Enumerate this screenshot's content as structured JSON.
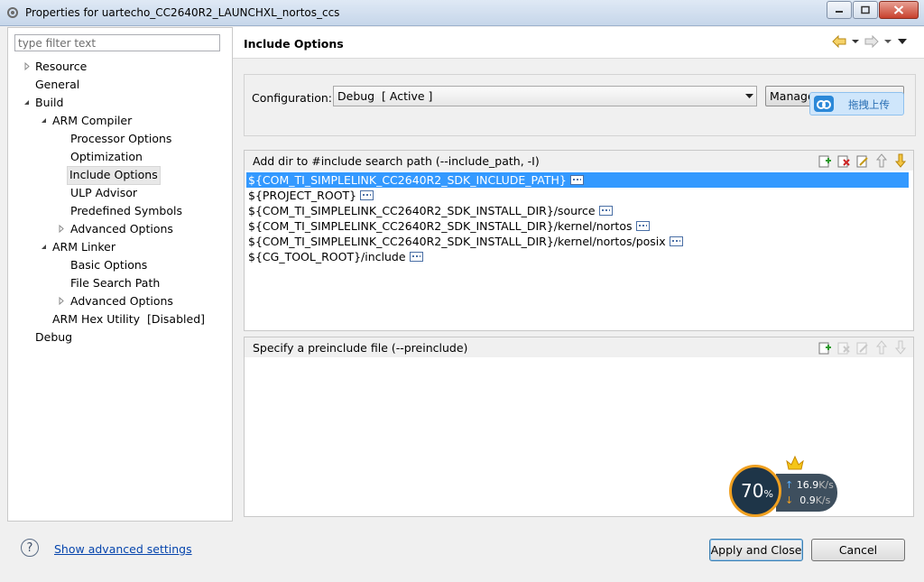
{
  "window": {
    "title": "Properties for uartecho_CC2640R2_LAUNCHXL_nortos_ccs"
  },
  "filter": {
    "placeholder": "type filter text"
  },
  "tree": {
    "resource": "Resource",
    "general": "General",
    "build": "Build",
    "arm_compiler": "ARM Compiler",
    "processor_options": "Processor Options",
    "optimization": "Optimization",
    "include_options": "Include Options",
    "ulp_advisor": "ULP Advisor",
    "predefined_symbols": "Predefined Symbols",
    "advanced_options_compiler": "Advanced Options",
    "arm_linker": "ARM Linker",
    "basic_options": "Basic Options",
    "file_search_path": "File Search Path",
    "advanced_options_linker": "Advanced Options",
    "arm_hex_utility": "ARM Hex Utility  [Disabled]",
    "debug": "Debug"
  },
  "page": {
    "title": "Include Options"
  },
  "configuration": {
    "label": "Configuration:",
    "value": "Debug  [ Active ]",
    "manage_label": "Manage"
  },
  "upload_overlay": {
    "label": "拖拽上传"
  },
  "include_panel": {
    "label": "Add dir to #include search path (--include_path, -I)",
    "paths": [
      "${COM_TI_SIMPLELINK_CC2640R2_SDK_INCLUDE_PATH}",
      "${PROJECT_ROOT}",
      "${COM_TI_SIMPLELINK_CC2640R2_SDK_INSTALL_DIR}/source",
      "${COM_TI_SIMPLELINK_CC2640R2_SDK_INSTALL_DIR}/kernel/nortos",
      "${COM_TI_SIMPLELINK_CC2640R2_SDK_INSTALL_DIR}/kernel/nortos/posix",
      "${CG_TOOL_ROOT}/include"
    ]
  },
  "preinclude_panel": {
    "label": "Specify a preinclude file (--preinclude)"
  },
  "net_widget": {
    "percent": "70",
    "percent_sign": "%",
    "upload": "16.9",
    "download": "0.9",
    "unit": "K/s",
    "badge": "VIP"
  },
  "footer": {
    "help": "?",
    "advanced_link": "Show advanced settings",
    "apply_close": "Apply and Close",
    "cancel": "Cancel"
  },
  "colors": {
    "selection": "#3399ff",
    "link": "#0645ad",
    "accent": "#f0a020"
  }
}
